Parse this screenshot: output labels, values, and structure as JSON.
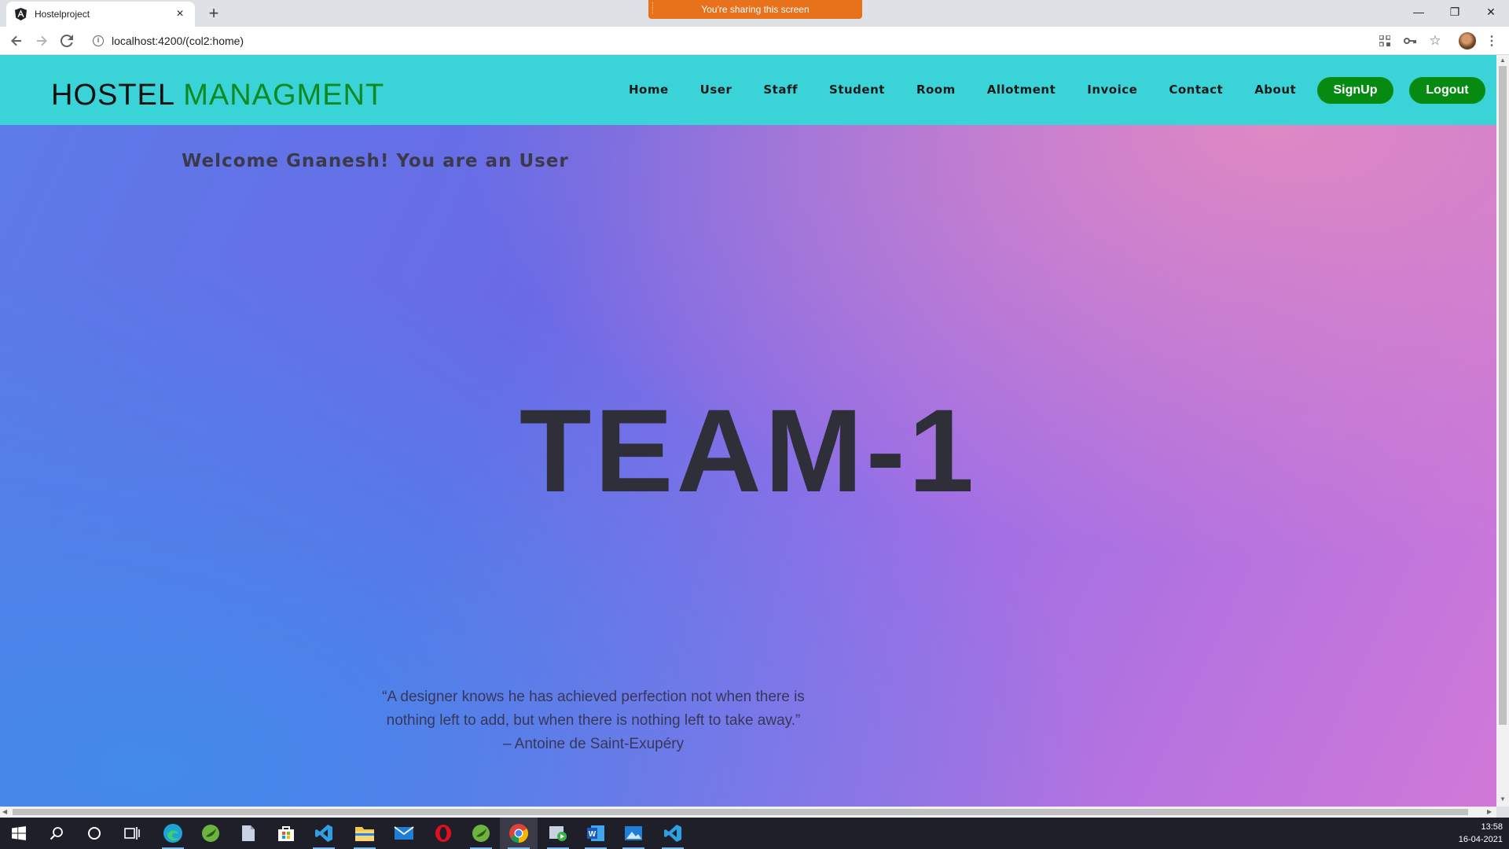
{
  "browser": {
    "tab_title": "Hostelproject",
    "new_tab_symbol": "+",
    "close_symbol": "×",
    "url": "localhost:4200/(col2:home)",
    "sharing_banner": "You're sharing this screen",
    "window_controls": {
      "minimize": "—",
      "restore": "❐",
      "close": "✕"
    }
  },
  "app": {
    "brand_part1": "HOSTEL",
    "brand_part2": "MANAGMENT",
    "nav": [
      "Home",
      "User",
      "Staff",
      "Student",
      "Room",
      "Allotment",
      "Invoice",
      "Contact",
      "About"
    ],
    "signup_label": "SignUp",
    "logout_label": "Logout",
    "welcome_text": "Welcome Gnanesh! You are an User",
    "hero_text": "TEAM-1",
    "quote_line1": "“A designer knows he has achieved perfection not when there is",
    "quote_line2": "nothing left to add, but when there is nothing left to take away.”",
    "quote_author": "– Antoine de Saint-Exupéry"
  },
  "colors": {
    "nav_bg": "#3ad3d8",
    "brand_green": "#0a8a1f",
    "pill_green": "#078a12",
    "sharing_orange": "#e8711c"
  },
  "taskbar": {
    "icons": [
      "windows-start-icon",
      "search-icon",
      "cortana-icon",
      "task-view-icon",
      "edge-icon",
      "spring-tools-icon",
      "files-icon",
      "store-icon",
      "vscode-icon",
      "file-explorer-icon",
      "mail-icon",
      "opera-icon",
      "spring-tools-2-icon",
      "chrome-icon",
      "media-icon",
      "word-icon",
      "photos-icon",
      "vscode-2-icon"
    ],
    "time": "13:58",
    "date": "16-04-2021"
  }
}
